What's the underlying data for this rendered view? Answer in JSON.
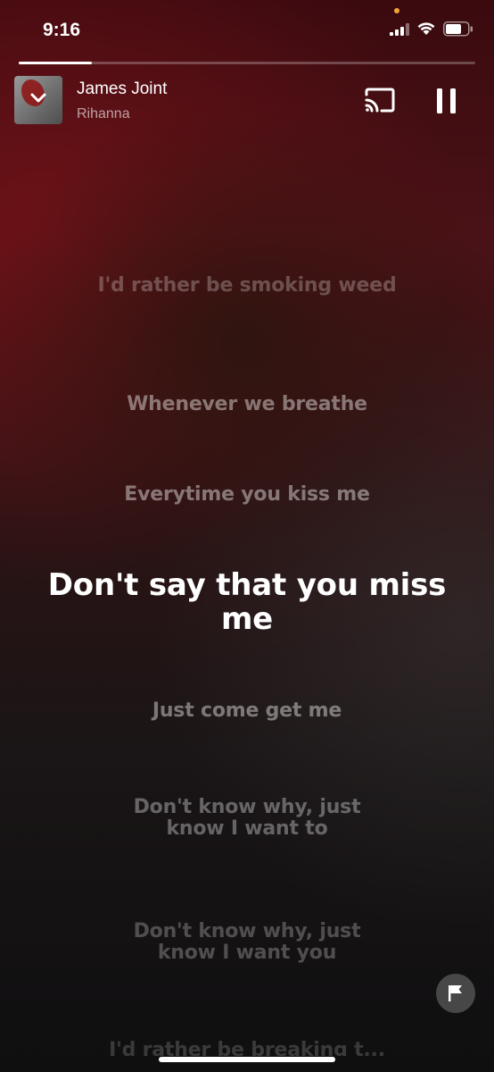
{
  "status_bar": {
    "time": "9:16",
    "icons": [
      "signal-icon",
      "wifi-icon",
      "battery-icon"
    ],
    "dot_color": "#f0a23a"
  },
  "player": {
    "progress_fraction": 0.16,
    "song_title": "James Joint",
    "artist": "Rihanna",
    "icons": [
      "chevron-down-icon",
      "cast-icon",
      "pause-icon"
    ]
  },
  "lyrics": {
    "lines": [
      "I'd rather be smoking weed",
      "Whenever we breathe",
      "Everytime you kiss me",
      "Don't say that you miss me",
      "Just come get me",
      "Don't know why, just know I want to",
      "Don't know why, just know I want you",
      "I'd rather be breaking t..."
    ],
    "active_index": 3
  },
  "controls": {
    "flag_icon": "flag-icon"
  },
  "colors": {
    "background_top": "#3a0a0f",
    "background_bottom": "#0f0f10",
    "accent_red": "#8e1717"
  }
}
